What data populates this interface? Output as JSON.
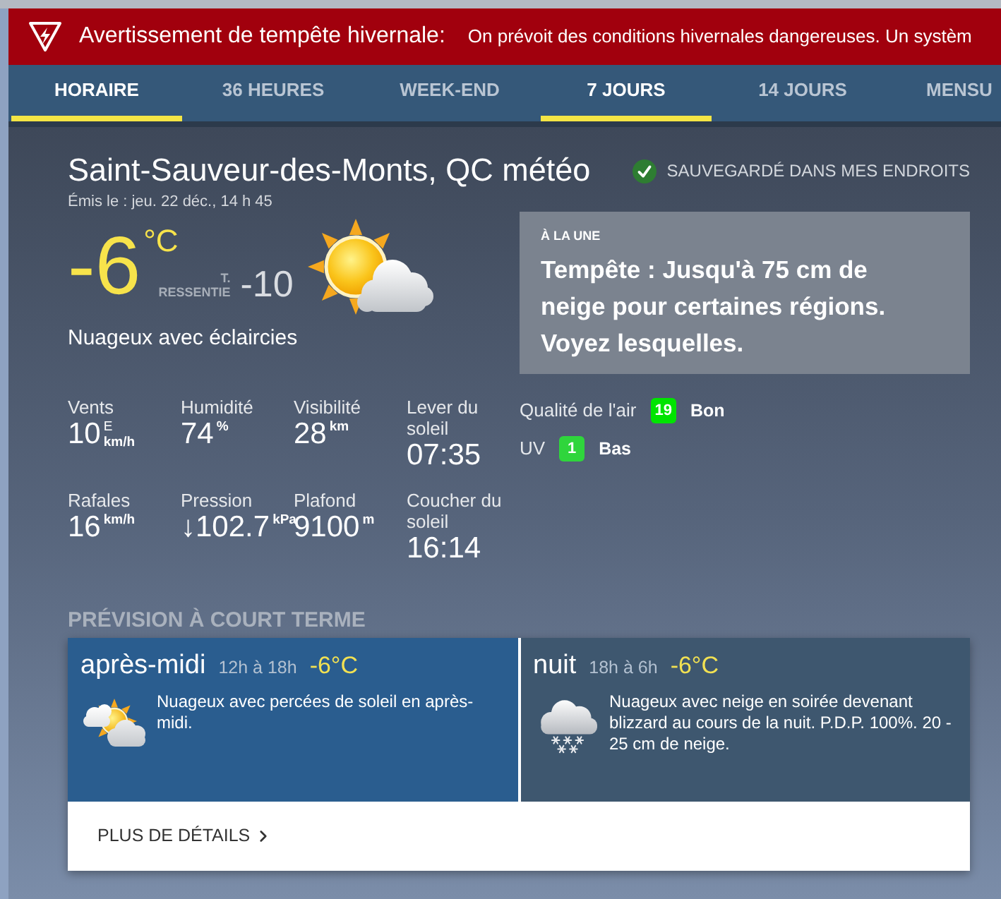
{
  "alert": {
    "title": "Avertissement de tempête hivernale:",
    "message": "On prévoit des conditions hivernales dangereuses. Un systèm"
  },
  "tabs": [
    {
      "label": "HORAIRE",
      "selected": true
    },
    {
      "label": "36 HEURES",
      "selected": false
    },
    {
      "label": "WEEK-END",
      "selected": false
    },
    {
      "label": "7 JOURS",
      "selected": true
    },
    {
      "label": "14 JOURS",
      "selected": false
    },
    {
      "label": "MENSU",
      "selected": false
    }
  ],
  "location": {
    "title": "Saint-Sauveur-des-Monts, QC météo",
    "saved": true,
    "saved_label": "SAUVEGARDÉ DANS MES ENDROITS",
    "issued": "Émis le : jeu. 22 déc., 14 h 45"
  },
  "current": {
    "temperature": "-6",
    "unit": "°C",
    "feels_like_label": "T. RESSENTIE",
    "feels_like": "-10",
    "condition": "Nuageux avec éclaircies"
  },
  "stats": [
    {
      "label": "Vents",
      "value": "10",
      "direction": "E",
      "unit": "km/h"
    },
    {
      "label": "Humidité",
      "value": "74",
      "unit": "%"
    },
    {
      "label": "Visibilité",
      "value": "28",
      "unit": "km"
    },
    {
      "label": "Lever du soleil",
      "value": "07:35"
    },
    {
      "label": "Rafales",
      "value": "16",
      "unit": "km/h"
    },
    {
      "label": "Pression",
      "value": "↓102.7",
      "unit": "kPa"
    },
    {
      "label": "Plafond",
      "value": "9100",
      "unit": "m"
    },
    {
      "label": "Coucher du soleil",
      "value": "16:14"
    }
  ],
  "featured": {
    "kicker": "À LA UNE",
    "headline": "Tempête : Jusqu'à 75 cm de neige pour certaines régions. Voyez lesquelles."
  },
  "indices": [
    {
      "label": "Qualité de l'air",
      "value": "19",
      "rating": "Bon",
      "color": "#00e400"
    },
    {
      "label": "UV",
      "value": "1",
      "rating": "Bas",
      "color": "#2fd53c"
    }
  ],
  "short_term": {
    "title": "PRÉVISION À COURT TERME",
    "periods": [
      {
        "name": "après-midi",
        "time": "12h à 18h",
        "temperature": "-6°C",
        "description": "Nuageux avec percées de soleil en après-midi."
      },
      {
        "name": "nuit",
        "time": "18h à 6h",
        "temperature": "-6°C",
        "description": "Nuageux avec neige en soirée devenant blizzard au cours de la nuit. P.D.P. 100%. 20 - 25 cm de neige."
      }
    ],
    "details_link": "PLUS DE DÉTAILS"
  }
}
